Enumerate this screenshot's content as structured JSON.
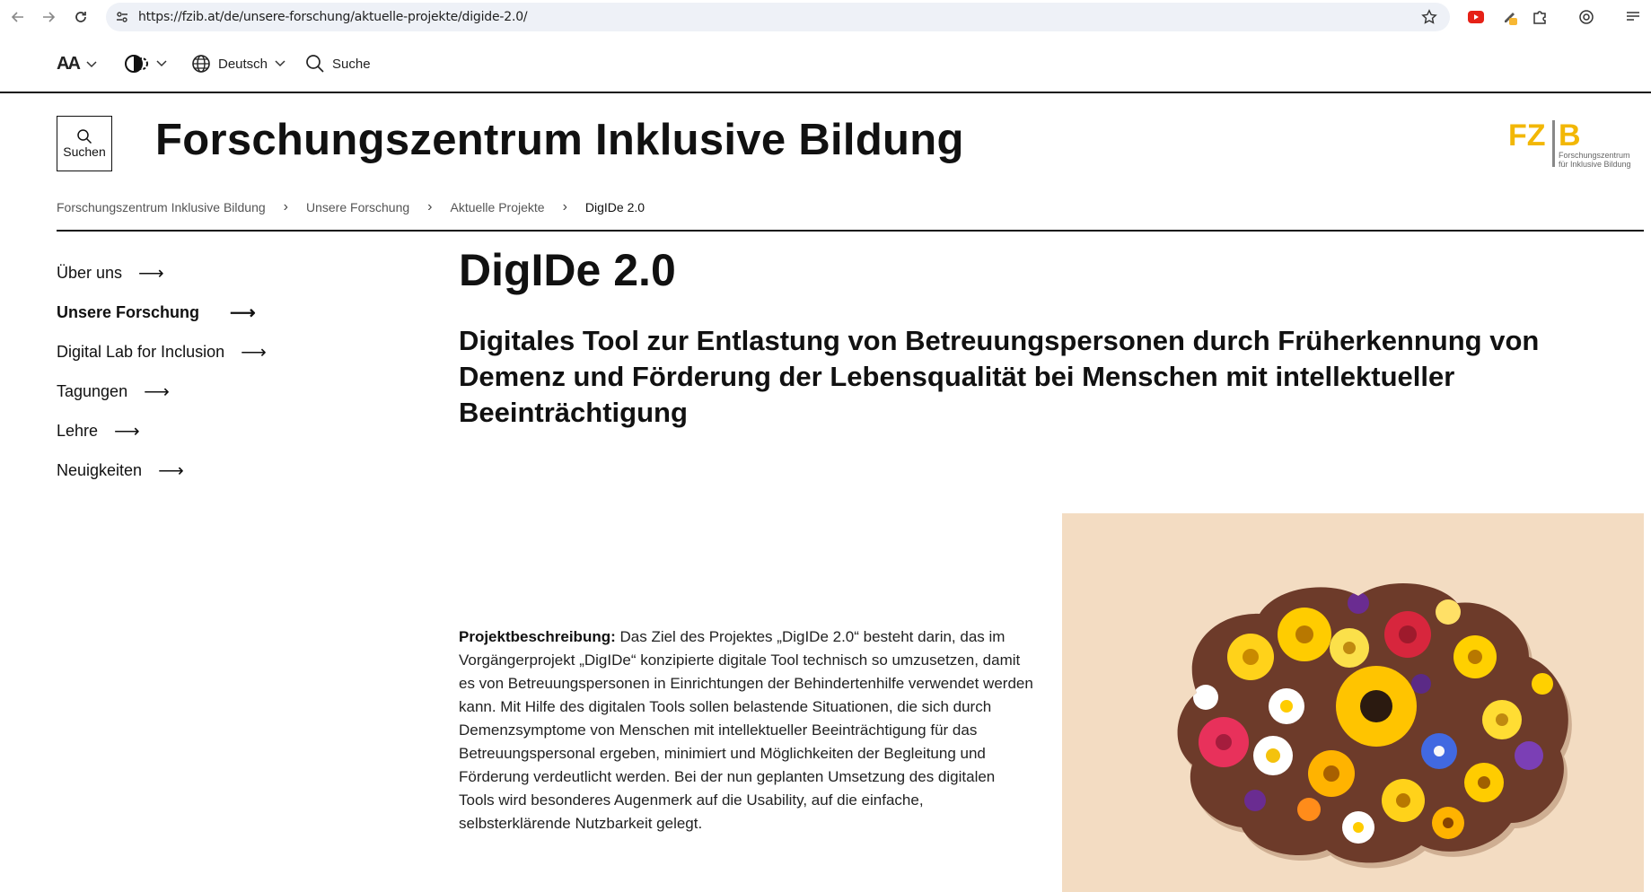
{
  "browser": {
    "url": "https://fzib.at/de/unsere-forschung/aktuelle-projekte/digide-2.0/"
  },
  "toolbar": {
    "font_size_label": "AA",
    "language": "Deutsch",
    "search_label": "Suche"
  },
  "header": {
    "search_button_label": "Suchen",
    "site_title": "Forschungszentrum Inklusive Bildung",
    "logo_text": "FZIB",
    "logo_sub1": "Forschungszentrum",
    "logo_sub2": "für Inklusive Bildung"
  },
  "breadcrumb": [
    "Forschungszentrum Inklusive Bildung",
    "Unsere Forschung",
    "Aktuelle Projekte",
    "DigIDe 2.0"
  ],
  "breadcrumb_separator": "›",
  "sidebar": {
    "items": [
      {
        "label": "Über uns"
      },
      {
        "label": "Unsere Forschung"
      },
      {
        "label": "Digital Lab for Inclusion"
      },
      {
        "label": "Tagungen"
      },
      {
        "label": "Lehre"
      },
      {
        "label": "Neuigkeiten"
      }
    ],
    "active_index": 1,
    "arrow": "⟶"
  },
  "main": {
    "title": "DigIDe 2.0",
    "subtitle": "Digitales Tool zur Entlastung von Betreuungspersonen durch Früherkennung von Demenz und Förderung der Lebensqualität bei Menschen mit intellektueller Beeinträchtigung",
    "description_label": "Projektbeschreibung:",
    "description_text": " Das Ziel des Projektes „DigIDe 2.0“ besteht darin, das im Vorgängerprojekt „DigIDe“ konzipierte digitale Tool technisch so umzusetzen, damit es von Betreuungspersonen in Einrichtungen der Behindertenhilfe verwendet werden kann. Mit Hilfe des digitalen Tools sollen belastende Situationen, die sich durch Demenzsymptome von Menschen mit intellektueller Beeinträchtigung für das Betreuungspersonal ergeben, minimiert und Möglichkeiten der Begleitung und Förderung verdeutlicht werden. Bei der nun geplanten Umsetzung des digitalen Tools wird besonderes Augenmerk auf die Usability, auf die einfache, selbsterklärende Nutzbarkeit gelegt."
  },
  "colors": {
    "logo_yellow": "#f2b705",
    "hero_bg": "#f3dcc2"
  }
}
